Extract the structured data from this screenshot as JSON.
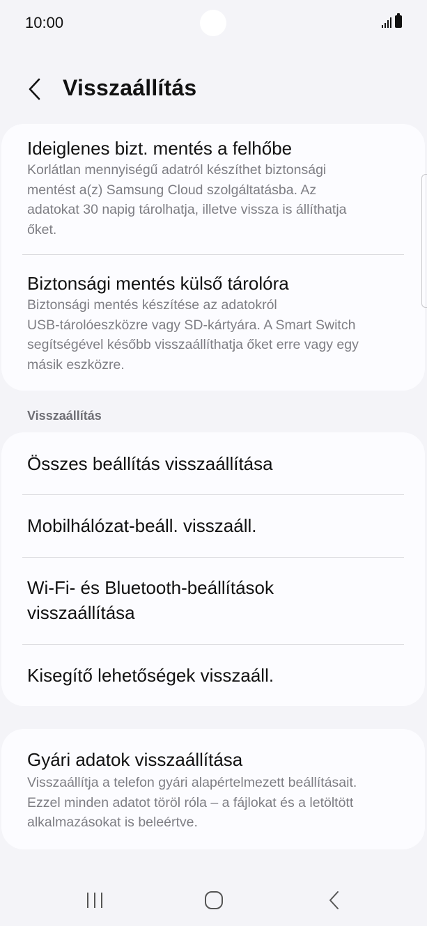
{
  "status_bar": {
    "time": "10:00"
  },
  "header": {
    "title": "Visszaállítás"
  },
  "backup_card": {
    "cloud": {
      "title": "Ideiglenes bizt. mentés a felhőbe",
      "desc_lines": [
        "Korlátlan mennyiségű adatról készíthet biztonsági",
        "mentést a(z) Samsung Cloud szolgáltatásba. Az",
        "adatokat 30 napig tárolhatja, illetve vissza is állíthatja",
        "őket."
      ]
    },
    "external": {
      "title": "Biztonsági mentés külső tárolóra",
      "desc_lines": [
        "Biztonsági mentés készítése az adatokról",
        "USB-tárolóeszközre vagy SD-kártyára. A Smart Switch",
        "segítségével később visszaállíthatja őket erre vagy egy",
        "másik eszközre."
      ]
    }
  },
  "reset_section": {
    "label": "Visszaállítás",
    "items": [
      {
        "label": "Összes beállítás visszaállítása"
      },
      {
        "label": "Mobilhálózat-beáll. visszaáll."
      },
      {
        "label_lines": [
          "Wi-Fi- és Bluetooth-beállítások",
          "visszaállítása"
        ]
      },
      {
        "label": "Kisegítő lehetőségek visszaáll."
      }
    ]
  },
  "factory_reset": {
    "title": "Gyári adatok visszaállítása",
    "desc_lines": [
      "Visszaállítja a telefon gyári alapértelmezett beállításait.",
      "Ezzel minden adatot töröl róla – a fájlokat és a letöltött",
      "alkalmazásokat is beleértve."
    ]
  },
  "icons": {
    "back": "chevron-left-icon",
    "recents": "recents-icon",
    "home": "home-icon",
    "nav_back": "nav-back-icon"
  },
  "colors": {
    "background": "#f4f4f8",
    "card": "#fcfcff",
    "secondary_text": "#7e7e84",
    "divider": "#dcdce0"
  }
}
